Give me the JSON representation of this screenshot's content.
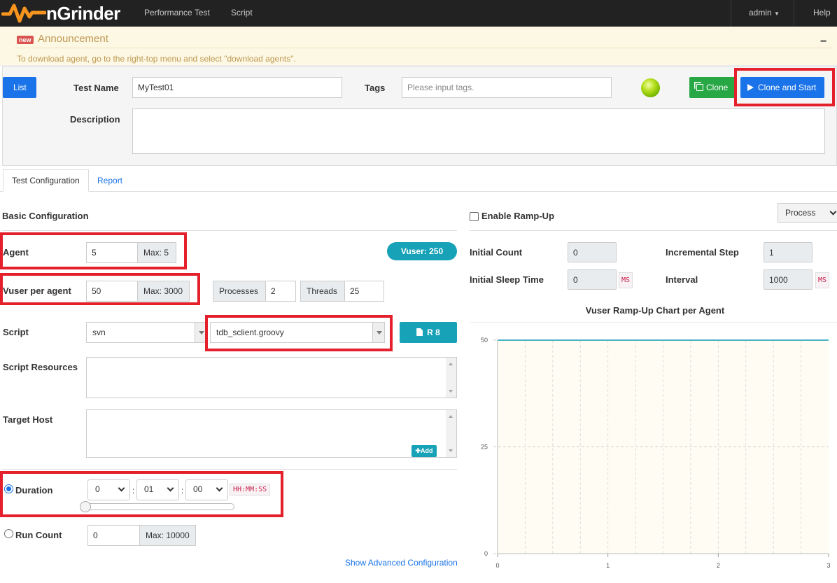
{
  "nav": {
    "brand": "nGrinder",
    "items": [
      "Performance Test",
      "Script"
    ],
    "user": "admin",
    "help": "Help",
    "logo_color": "#f7941d"
  },
  "announcement": {
    "badge": "new",
    "title": "Announcement",
    "text": "To download agent, go to the right-top menu and select \"download agents\".",
    "collapse": "−"
  },
  "header": {
    "list_label": "List",
    "test_name_label": "Test Name",
    "test_name_value": "MyTest01",
    "tags_label": "Tags",
    "tags_placeholder": "Please input tags.",
    "description_label": "Description",
    "description_value": "",
    "status_icon": "ready-green-ball",
    "clone_label": "Clone",
    "clone_start_label": "Clone and Start"
  },
  "tabs": [
    {
      "label": "Test Configuration",
      "active": true
    },
    {
      "label": "Report",
      "active": false
    }
  ],
  "basic": {
    "section_title": "Basic Configuration",
    "agent_label": "Agent",
    "agent_value": "5",
    "agent_max": "Max: 5",
    "vuser_badge": "Vuser: 250",
    "vuser_label": "Vuser per agent",
    "vuser_value": "50",
    "vuser_max": "Max: 3000",
    "processes_label": "Processes",
    "processes_value": "2",
    "threads_label": "Threads",
    "threads_value": "25",
    "script_label": "Script",
    "script_repo": "svn",
    "script_file": "tdb_sclient.groovy",
    "script_rev_button": "R 8",
    "resources_label": "Script Resources",
    "target_host_label": "Target Host",
    "add_button": "Add",
    "duration_label": "Duration",
    "duration_selected": true,
    "duration_hh": "0",
    "duration_mm": "01",
    "duration_ss": "00",
    "duration_format": "HH:MM:SS",
    "duration_slider_fraction": 0.0,
    "run_count_label": "Run Count",
    "run_count_value": "0",
    "run_count_max": "Max: 10000",
    "advanced_link": "Show Advanced Configuration"
  },
  "rampup": {
    "enable_label": "Enable Ramp-Up",
    "enabled": false,
    "mode": "Process",
    "initial_count_label": "Initial Count",
    "initial_count": "0",
    "incremental_step_label": "Incremental Step",
    "incremental_step": "1",
    "initial_sleep_label": "Initial Sleep Time",
    "initial_sleep": "0",
    "interval_label": "Interval",
    "interval": "1000",
    "ms_unit": "MS"
  },
  "chart_data": {
    "type": "line",
    "title": "Vuser Ramp-Up Chart per Agent",
    "xlabel": "",
    "ylabel": "",
    "x_ticks": [
      "0",
      "1",
      "2",
      "3"
    ],
    "y_ticks": [
      "0",
      "25",
      "50"
    ],
    "xlim": [
      0,
      3
    ],
    "ylim": [
      0,
      50
    ],
    "series": [
      {
        "x": [
          0,
          3
        ],
        "y": [
          50,
          50
        ],
        "color": "#4bb3c6"
      }
    ],
    "grid": true
  }
}
